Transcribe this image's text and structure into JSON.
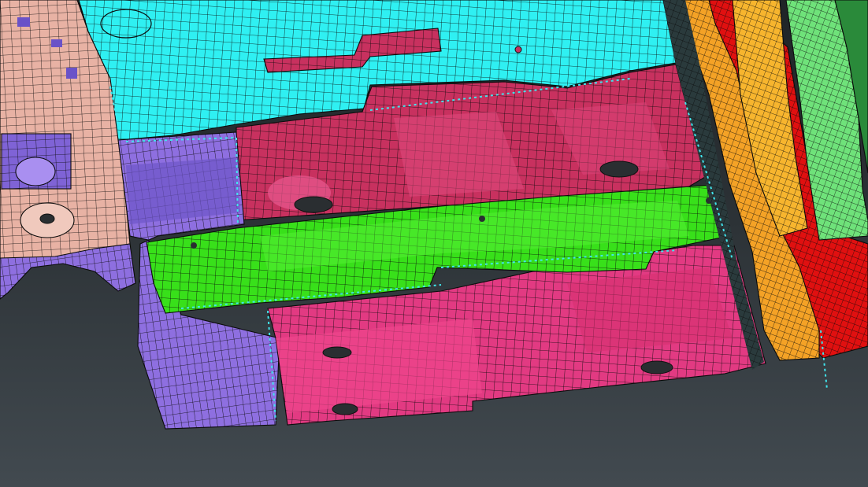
{
  "viewport": {
    "background_top": "#1f2427",
    "background_bottom": "#424a50",
    "mesh_line_color": "#0a0a0a",
    "weld_point_color": "#41e6ee"
  },
  "parts": [
    {
      "id": "cyan-upper-floor-panel",
      "color": "#2ff0f2"
    },
    {
      "id": "magenta-crossmember-upper",
      "color": "#c8315f"
    },
    {
      "id": "magenta-crossmember-lower",
      "color": "#e23a82"
    },
    {
      "id": "green-reinforcement-rail",
      "color": "#38e01a"
    },
    {
      "id": "violet-side-bracket",
      "color": "#8e6fe0"
    },
    {
      "id": "tan-tunnel-panel",
      "color": "#e8b2a4"
    },
    {
      "id": "orange-sill-member",
      "color": "#f4a226"
    },
    {
      "id": "red-sill-inner",
      "color": "#e01010"
    },
    {
      "id": "light-green-rocker-panel",
      "color": "#6fe27a"
    }
  ]
}
